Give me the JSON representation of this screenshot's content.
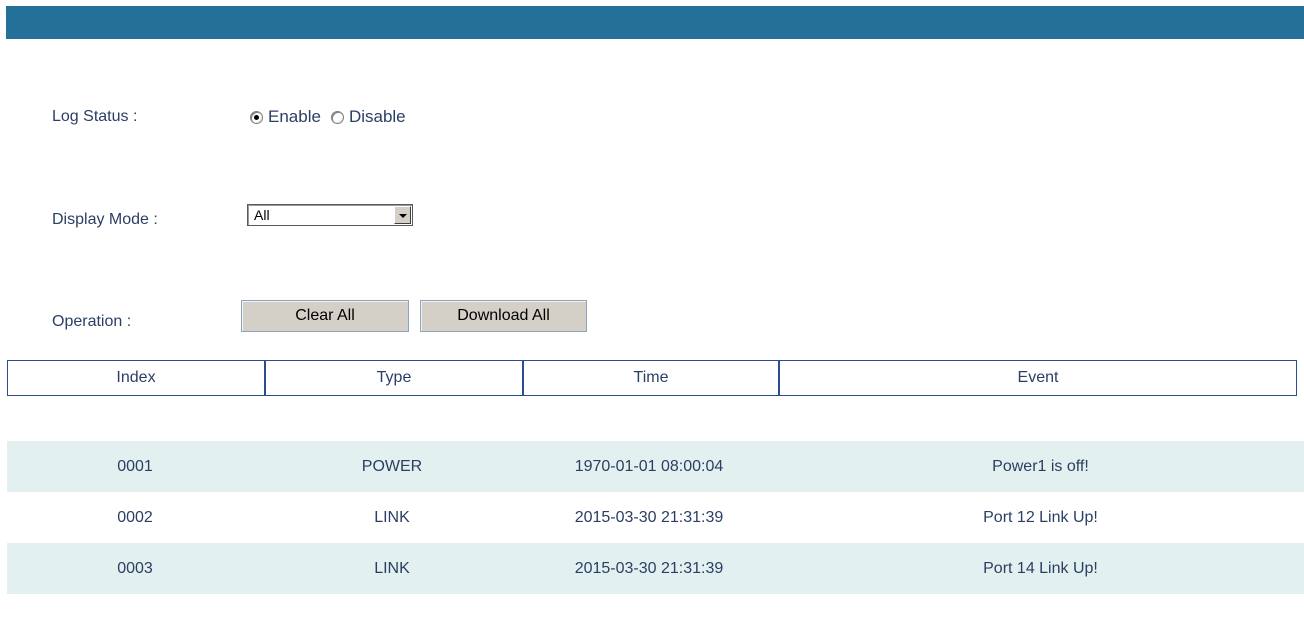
{
  "form": {
    "log_status_label": "Log Status :",
    "log_status_options": [
      {
        "label": "Enable",
        "checked": true
      },
      {
        "label": "Disable",
        "checked": false
      }
    ],
    "display_mode_label": "Display Mode :",
    "display_mode_value": "All",
    "operation_label": "Operation :",
    "clear_all_label": "Clear All",
    "download_all_label": "Download All"
  },
  "table": {
    "columns": [
      "Index",
      "Type",
      "Time",
      "Event"
    ],
    "rows": [
      {
        "index": "0001",
        "type": "POWER",
        "time": "1970-01-01 08:00:04",
        "event": "Power1 is off!"
      },
      {
        "index": "0002",
        "type": "LINK",
        "time": "2015-03-30 21:31:39",
        "event": "Port 12 Link Up!"
      },
      {
        "index": "0003",
        "type": "LINK",
        "time": "2015-03-30 21:31:39",
        "event": "Port 14 Link Up!"
      }
    ]
  },
  "colors": {
    "header_bar": "#257098",
    "text": "#2b3e63",
    "row_stripe": "#e2f0ef",
    "table_border": "#2b4d8e"
  }
}
